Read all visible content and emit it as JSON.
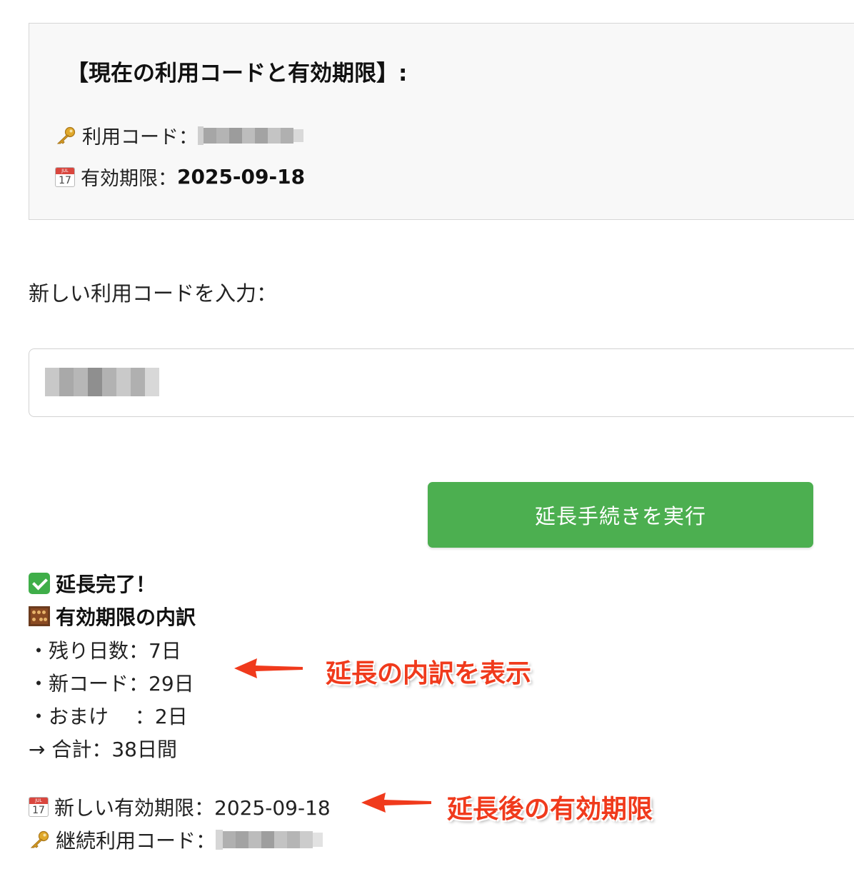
{
  "current": {
    "title": "【現在の利用コードと有効期限】:",
    "code_label": "利用コード：",
    "expiry_label": "有効期限：",
    "expiry_value": "2025-09-18"
  },
  "new_code": {
    "label": "新しい利用コードを入力："
  },
  "button": {
    "extend_label": "延長手続きを実行"
  },
  "result": {
    "done": "延長完了！",
    "breakdown_title": "有効期限の内訳",
    "remaining_days": "・残り日数：7日",
    "new_code_days": "・新コード：29日",
    "bonus_days": "・おまけ　 ：2日",
    "total": "→ 合計：38日間",
    "new_expiry": "新しい有効期限：2025-09-18",
    "continued_code_label": "継続利用コード："
  },
  "annotations": {
    "breakdown_note": "延長の内訳を表示",
    "expiry_note": "延長後の有効期限"
  },
  "colors": {
    "button_green": "#4caf50",
    "annotation_red": "#f03a1c",
    "box_background": "#f8f8f8"
  },
  "icons": [
    "key-icon",
    "calendar-icon",
    "check-icon",
    "abacus-icon"
  ]
}
